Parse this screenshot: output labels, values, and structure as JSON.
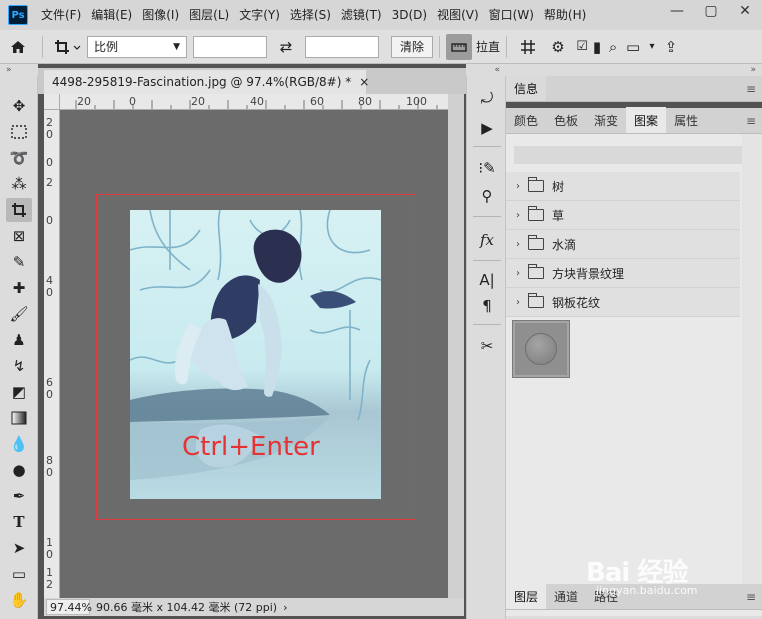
{
  "app": {
    "logo": "Ps"
  },
  "menu": [
    "文件(F)",
    "编辑(E)",
    "图像(I)",
    "图层(L)",
    "文字(Y)",
    "选择(S)",
    "滤镜(T)",
    "3D(D)",
    "视图(V)",
    "窗口(W)",
    "帮助(H)"
  ],
  "window": {
    "minimize": "—",
    "restore": "▢",
    "close": "✕"
  },
  "options": {
    "ratio_value": "比例",
    "clear_label": "清除",
    "straighten_label": "拉直"
  },
  "document": {
    "tab_title": "4498-295819-Fascination.jpg @ 97.4%(RGB/8#) *",
    "close_glyph": "×",
    "ruler_h": [
      "20",
      "0",
      "20",
      "40",
      "60",
      "80",
      "100"
    ],
    "ruler_v": [
      "2",
      "0",
      "0",
      "2",
      "0",
      "4",
      "0",
      "6",
      "0",
      "8",
      "0",
      "1",
      "0",
      "1",
      "2"
    ],
    "canvas_hint": "Ctrl+Enter"
  },
  "status": {
    "zoom": "97.44%",
    "doc_info": "90.66 毫米 x 104.42 毫米 (72 ppi)",
    "arrow": "›"
  },
  "panels": {
    "info_tab": "信息",
    "tabs": [
      "颜色",
      "色板",
      "渐变",
      "图案",
      "属性"
    ],
    "active_tab": "图案",
    "pattern_groups": [
      "树",
      "草",
      "水滴",
      "方块背景纹理",
      "钢板花纹"
    ],
    "layer_tabs": [
      "图层",
      "通道",
      "路径"
    ]
  },
  "watermark": {
    "brand": "Bai 经验",
    "url": "jingyan.baidu.com"
  }
}
